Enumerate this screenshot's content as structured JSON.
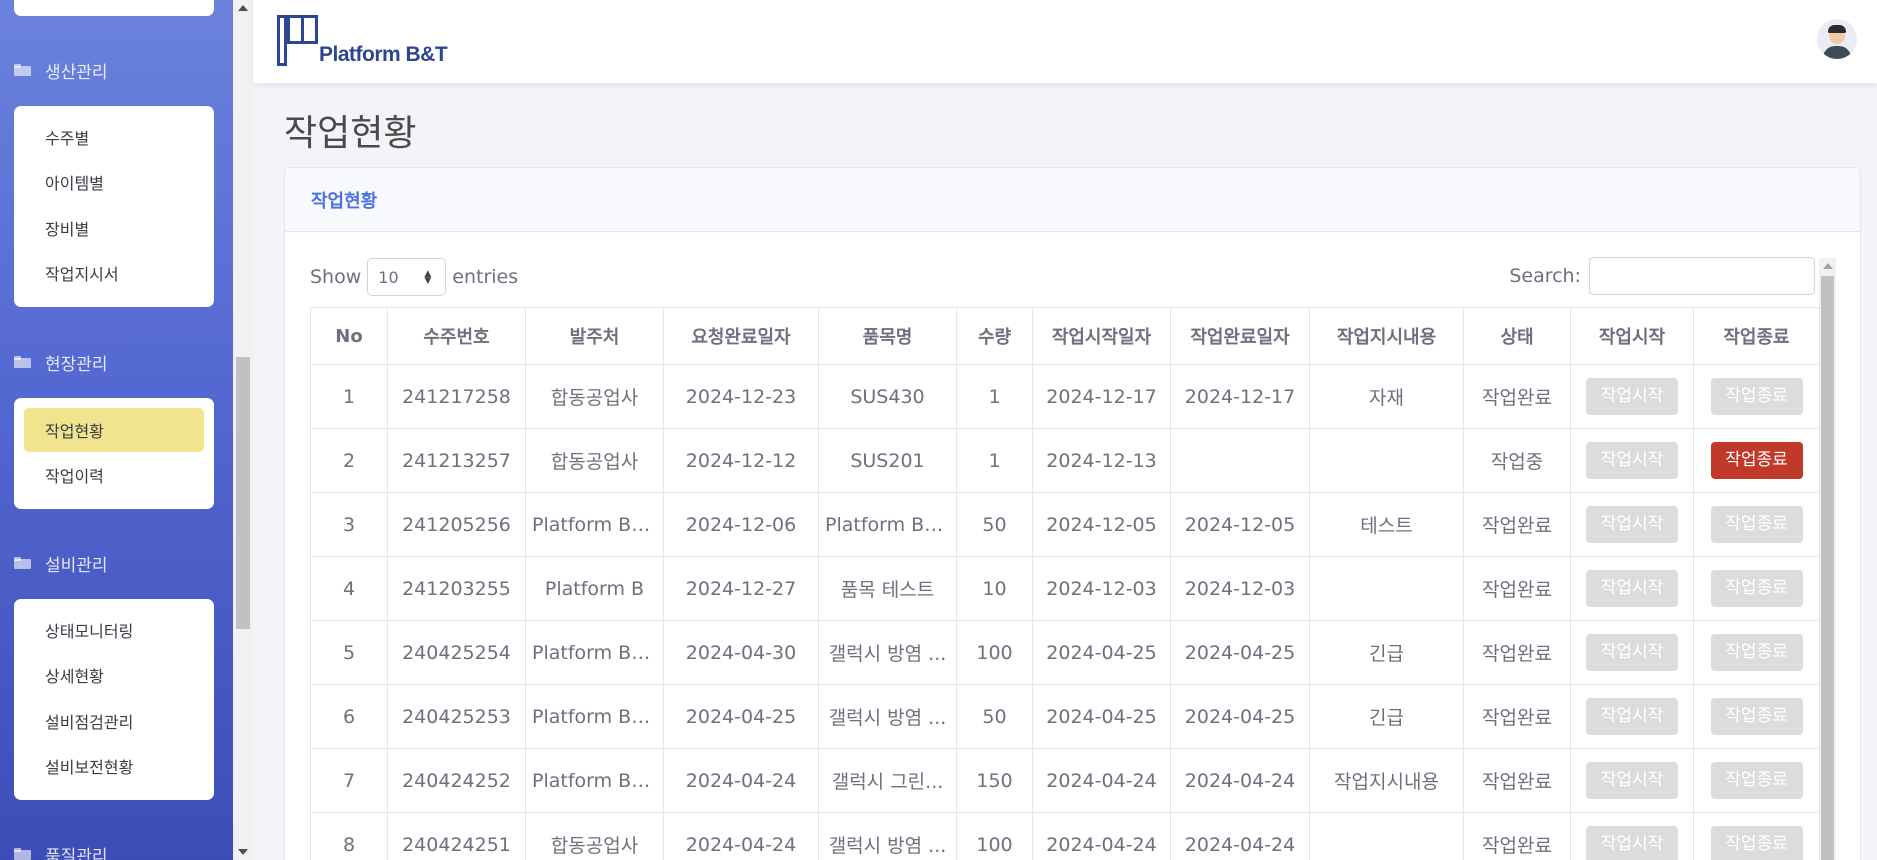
{
  "sidebar": {
    "sections": [
      {
        "label": "생산관리"
      },
      {
        "label": "현장관리"
      },
      {
        "label": "설비관리"
      },
      {
        "label": "품질관리"
      }
    ],
    "production_items": [
      {
        "label": "수주별"
      },
      {
        "label": "아이템별"
      },
      {
        "label": "장비별"
      },
      {
        "label": "작업지시서"
      }
    ],
    "field_items": [
      {
        "label": "작업현황"
      },
      {
        "label": "작업이력"
      }
    ],
    "equipment_items": [
      {
        "label": "상태모니터링"
      },
      {
        "label": "상세현황"
      },
      {
        "label": "설비점검관리"
      },
      {
        "label": "설비보전현황"
      }
    ],
    "active_item": "작업현황"
  },
  "header": {
    "logo_text": "Platform B&T",
    "avatar_icon": "user-avatar-icon"
  },
  "page": {
    "title": "작업현황",
    "card_title": "작업현황",
    "show_label": "Show",
    "entries_value": "10",
    "entries_label": "entries",
    "search_label": "Search:",
    "search_value": ""
  },
  "table": {
    "headers": [
      "No",
      "수주번호",
      "발주처",
      "요청완료일자",
      "품목명",
      "수량",
      "작업시작일자",
      "작업완료일자",
      "작업지시내용",
      "상태",
      "작업시작",
      "작업종료"
    ],
    "start_label": "작업시작",
    "end_label": "작업종료",
    "rows": [
      {
        "no": "1",
        "order": "241217258",
        "client": "합동공업사",
        "due": "2024-12-23",
        "item": "SUS430",
        "qty": "1",
        "start": "2024-12-17",
        "end": "2024-12-17",
        "memo": "자재",
        "status": "작업완료",
        "start_enabled": false,
        "end_enabled": false
      },
      {
        "no": "2",
        "order": "241213257",
        "client": "합동공업사",
        "due": "2024-12-12",
        "item": "SUS201",
        "qty": "1",
        "start": "2024-12-13",
        "end": "",
        "memo": "",
        "status": "작업중",
        "start_enabled": false,
        "end_enabled": true
      },
      {
        "no": "3",
        "order": "241205256",
        "client": "Platform B&T",
        "due": "2024-12-06",
        "item": "Platform B&...",
        "qty": "50",
        "start": "2024-12-05",
        "end": "2024-12-05",
        "memo": "테스트",
        "status": "작업완료",
        "start_enabled": false,
        "end_enabled": false
      },
      {
        "no": "4",
        "order": "241203255",
        "client": "Platform B",
        "due": "2024-12-27",
        "item": "품목 테스트",
        "qty": "10",
        "start": "2024-12-03",
        "end": "2024-12-03",
        "memo": "",
        "status": "작업완료",
        "start_enabled": false,
        "end_enabled": false
      },
      {
        "no": "5",
        "order": "240425254",
        "client": "Platform B&T",
        "due": "2024-04-30",
        "item": "갤럭시 방염 ...",
        "qty": "100",
        "start": "2024-04-25",
        "end": "2024-04-25",
        "memo": "긴급",
        "status": "작업완료",
        "start_enabled": false,
        "end_enabled": false
      },
      {
        "no": "6",
        "order": "240425253",
        "client": "Platform B&T",
        "due": "2024-04-25",
        "item": "갤럭시 방염 ...",
        "qty": "50",
        "start": "2024-04-25",
        "end": "2024-04-25",
        "memo": "긴급",
        "status": "작업완료",
        "start_enabled": false,
        "end_enabled": false
      },
      {
        "no": "7",
        "order": "240424252",
        "client": "Platform B&T",
        "due": "2024-04-24",
        "item": "갤럭시 그린...",
        "qty": "150",
        "start": "2024-04-24",
        "end": "2024-04-24",
        "memo": "작업지시내용",
        "status": "작업완료",
        "start_enabled": false,
        "end_enabled": false
      },
      {
        "no": "8",
        "order": "240424251",
        "client": "합동공업사",
        "due": "2024-04-24",
        "item": "갤럭시 방염 ...",
        "qty": "100",
        "start": "2024-04-24",
        "end": "2024-04-24",
        "memo": "",
        "status": "작업완료",
        "start_enabled": false,
        "end_enabled": false
      }
    ]
  },
  "colors": {
    "sidebar_top": "#6b82dd",
    "sidebar_bottom": "#3d4db7",
    "active_item_bg": "#f0e48f",
    "accent": "#4e73df",
    "end_button_active": "#c0392b",
    "button_disabled": "#dcdcdc"
  }
}
